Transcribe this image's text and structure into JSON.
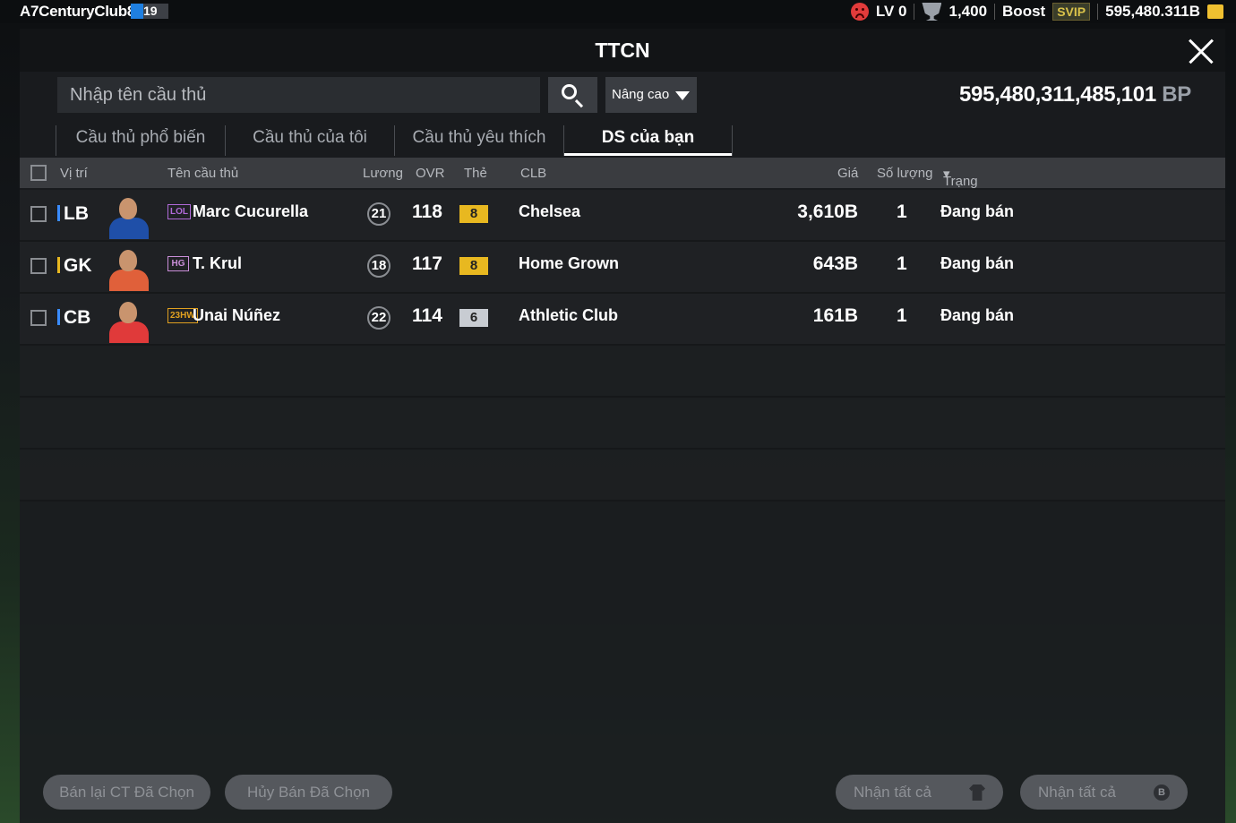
{
  "topbar": {
    "user_name": "A7CenturyClub8",
    "user_level": "19",
    "lv_text": "LV 0",
    "cup_count": "1,400",
    "boost_label": "Boost",
    "svip_label": "SVIP",
    "coins": "595,480.311B"
  },
  "window": {
    "title": "TTCN"
  },
  "search": {
    "placeholder": "Nhập tên cầu thủ",
    "advanced_label": "Nâng cao",
    "bp_amount": "595,480,311,485,101",
    "bp_unit": "BP"
  },
  "tabs": [
    {
      "label": "Cầu thủ phổ biến",
      "active": false
    },
    {
      "label": "Cầu thủ của tôi",
      "active": false
    },
    {
      "label": "Cầu thủ yêu thích",
      "active": false
    },
    {
      "label": "DS của bạn",
      "active": true
    }
  ],
  "table": {
    "columns": {
      "position": "Vị trí",
      "name": "Tên cầu thủ",
      "salary": "Lương",
      "ovr": "OVR",
      "card": "Thẻ",
      "club": "CLB",
      "price": "Giá",
      "quantity": "Số lượng",
      "status": "Trạng thái"
    },
    "rows": [
      {
        "position": "LB",
        "pos_color": "#3a8cff",
        "season": "LOL",
        "season_color": "#b06ad8",
        "name": "Marc Cucurella",
        "salary": "21",
        "ovr": "118",
        "card": "8",
        "card_color": "#e8b820",
        "club": "Chelsea",
        "price": "3,610B",
        "quantity": "1",
        "status": "Đang bán",
        "kit": "#1f4fa8"
      },
      {
        "position": "GK",
        "pos_color": "#e8b820",
        "season": "HG",
        "season_color": "#c98ed8",
        "name": "T. Krul",
        "salary": "18",
        "ovr": "117",
        "card": "8",
        "card_color": "#e8b820",
        "club": "Home Grown",
        "price": "643B",
        "quantity": "1",
        "status": "Đang bán",
        "kit": "#e0603a"
      },
      {
        "position": "CB",
        "pos_color": "#3a8cff",
        "season": "23HW",
        "season_color": "#e0a020",
        "name": "Unai Núñez",
        "salary": "22",
        "ovr": "114",
        "card": "6",
        "card_color": "#c8ccd2",
        "club": "Athletic Club",
        "price": "161B",
        "quantity": "1",
        "status": "Đang bán",
        "kit": "#e03a3a"
      }
    ]
  },
  "footer": {
    "resell_selected": "Bán lại CT Đã Chọn",
    "cancel_selected": "Hủy Bán Đã Chọn",
    "receive_all_1": "Nhận tất cả",
    "receive_all_2": "Nhận tất cả",
    "coin_glyph": "B"
  }
}
